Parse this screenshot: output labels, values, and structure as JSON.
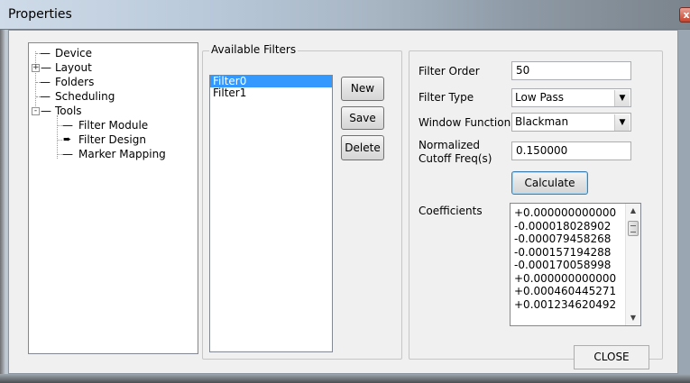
{
  "window": {
    "title": "Properties",
    "close_glyph": "x"
  },
  "tree": {
    "items": [
      {
        "label": "Device",
        "expander": ""
      },
      {
        "label": "Layout",
        "expander": "+"
      },
      {
        "label": "Folders",
        "expander": ""
      },
      {
        "label": "Scheduling",
        "expander": ""
      },
      {
        "label": "Tools",
        "expander": "-"
      },
      {
        "label": "Filter Module",
        "expander": ""
      },
      {
        "label": "Filter Design",
        "expander": ""
      },
      {
        "label": "Marker Mapping",
        "expander": ""
      }
    ],
    "selected_marker_icon": "arrow-right-icon"
  },
  "available_filters": {
    "title": "Available Filters",
    "items": [
      "Filter0",
      "Filter1"
    ],
    "selected": "Filter0",
    "buttons": {
      "new": "New",
      "save": "Save",
      "delete": "Delete"
    }
  },
  "params": {
    "filter_order_label": "Filter Order",
    "filter_order_value": "50",
    "filter_type_label": "Filter Type",
    "filter_type_value": "Low Pass",
    "window_function_label": "Window Function",
    "window_function_value": "Blackman",
    "cutoff_label_line1": "Normalized",
    "cutoff_label_line2": "Cutoff Freq(s)",
    "cutoff_value": "0.150000",
    "calculate_button": "Calculate",
    "coefficients_label": "Coefficients",
    "coefficients": [
      "+0.000000000000",
      "-0.000018028902",
      "-0.000079458268",
      "-0.000157194288",
      "-0.000170058998",
      "+0.000000000000",
      "+0.000460445271",
      "+0.001234620492"
    ]
  },
  "footer": {
    "close_button": "CLOSE"
  },
  "colors": {
    "selection": "#3399ff",
    "dialog_bg": "#f0f0f0",
    "close_red": "#c6432c"
  }
}
